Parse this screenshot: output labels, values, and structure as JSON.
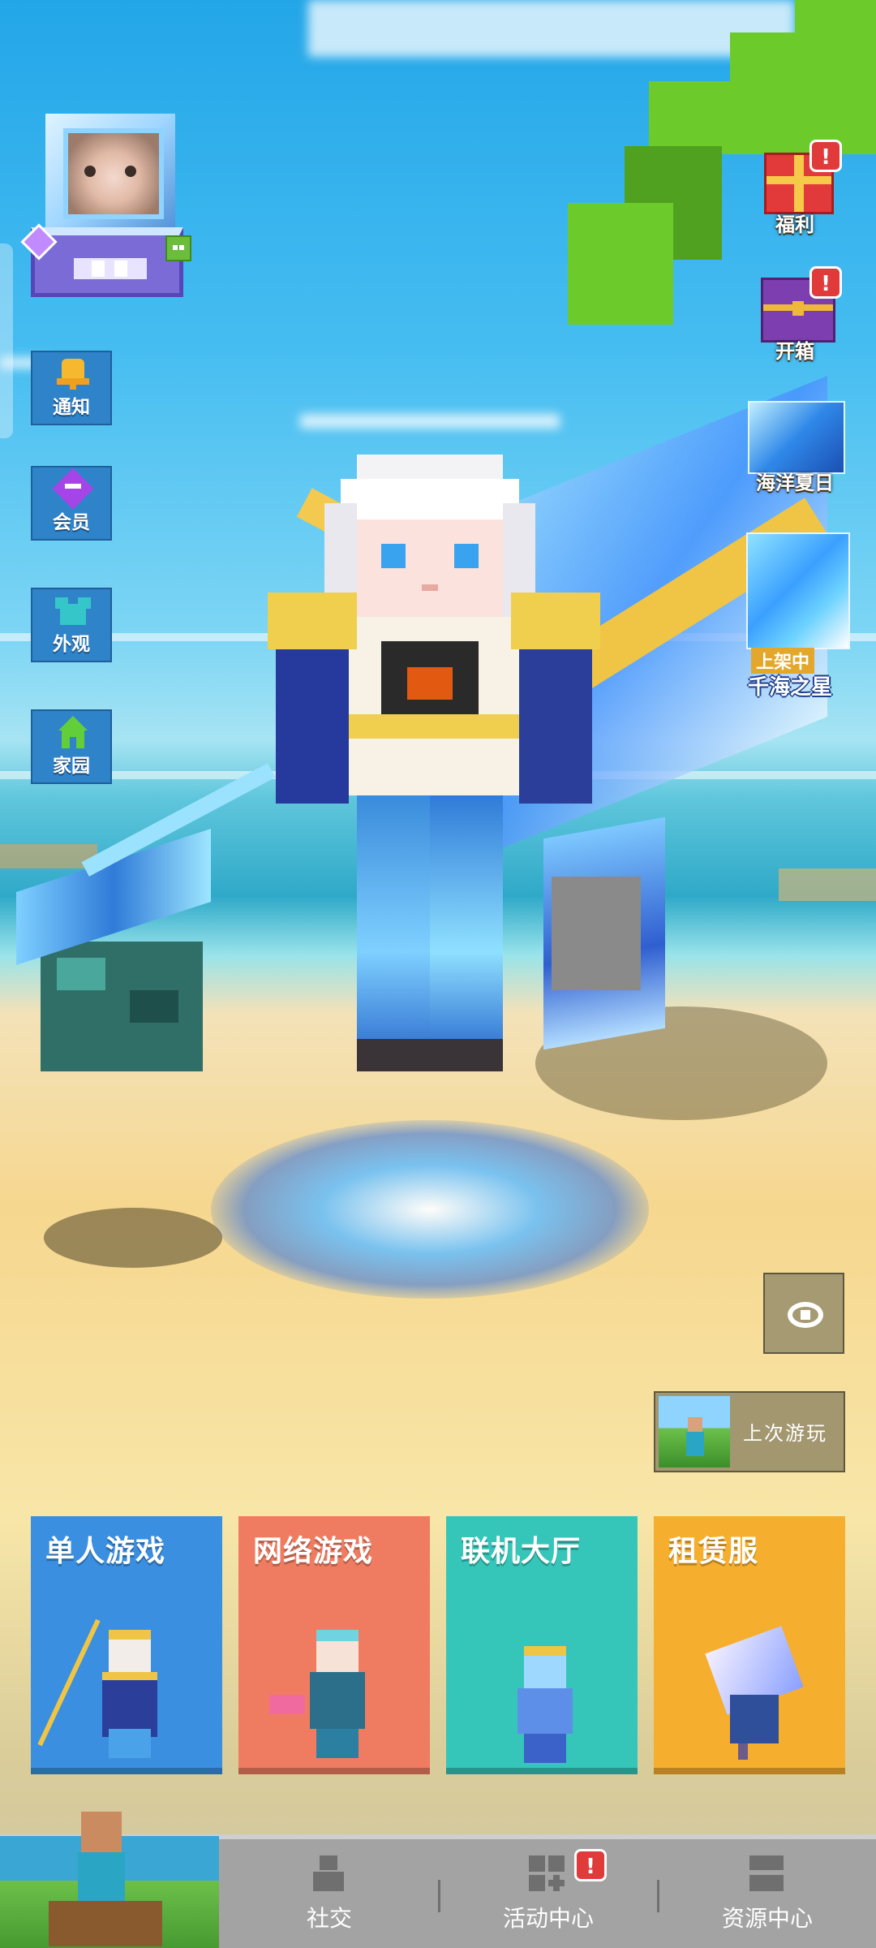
{
  "sidebar_left": {
    "items": [
      {
        "label": "通知",
        "icon": "bell-icon"
      },
      {
        "label": "会员",
        "icon": "vip-heart-icon"
      },
      {
        "label": "外观",
        "icon": "outfit-icon"
      },
      {
        "label": "家园",
        "icon": "home-icon"
      }
    ]
  },
  "sidebar_right": {
    "items": [
      {
        "label": "福利",
        "icon": "gift-box-icon",
        "badge": "!"
      },
      {
        "label": "开箱",
        "icon": "treasure-chest-icon",
        "badge": "!"
      },
      {
        "label": "海洋夏日",
        "icon": "ocean-summer-event-icon"
      }
    ],
    "promo": {
      "tag": "上架中",
      "title": "千海之星"
    }
  },
  "actions": {
    "last_played_label": "上次游玩"
  },
  "modes": [
    {
      "title": "单人游戏",
      "color": "#3a8fe0"
    },
    {
      "title": "网络游戏",
      "color": "#ef7c60"
    },
    {
      "title": "联机大厅",
      "color": "#35c6b9"
    },
    {
      "title": "租赁服",
      "color": "#f6ae2e"
    }
  ],
  "bottom_nav": {
    "items": [
      {
        "label": "社交",
        "icon": "social-icon"
      },
      {
        "label": "活动中心",
        "icon": "activity-center-icon",
        "badge": "!"
      },
      {
        "label": "资源中心",
        "icon": "resource-center-icon"
      }
    ]
  },
  "colors": {
    "sky": "#46bdf1",
    "sand": "#f6d78f",
    "side_button": "#2f83c9",
    "badge": "#e03a3a",
    "bottom_nav": "#a3a3a3"
  }
}
